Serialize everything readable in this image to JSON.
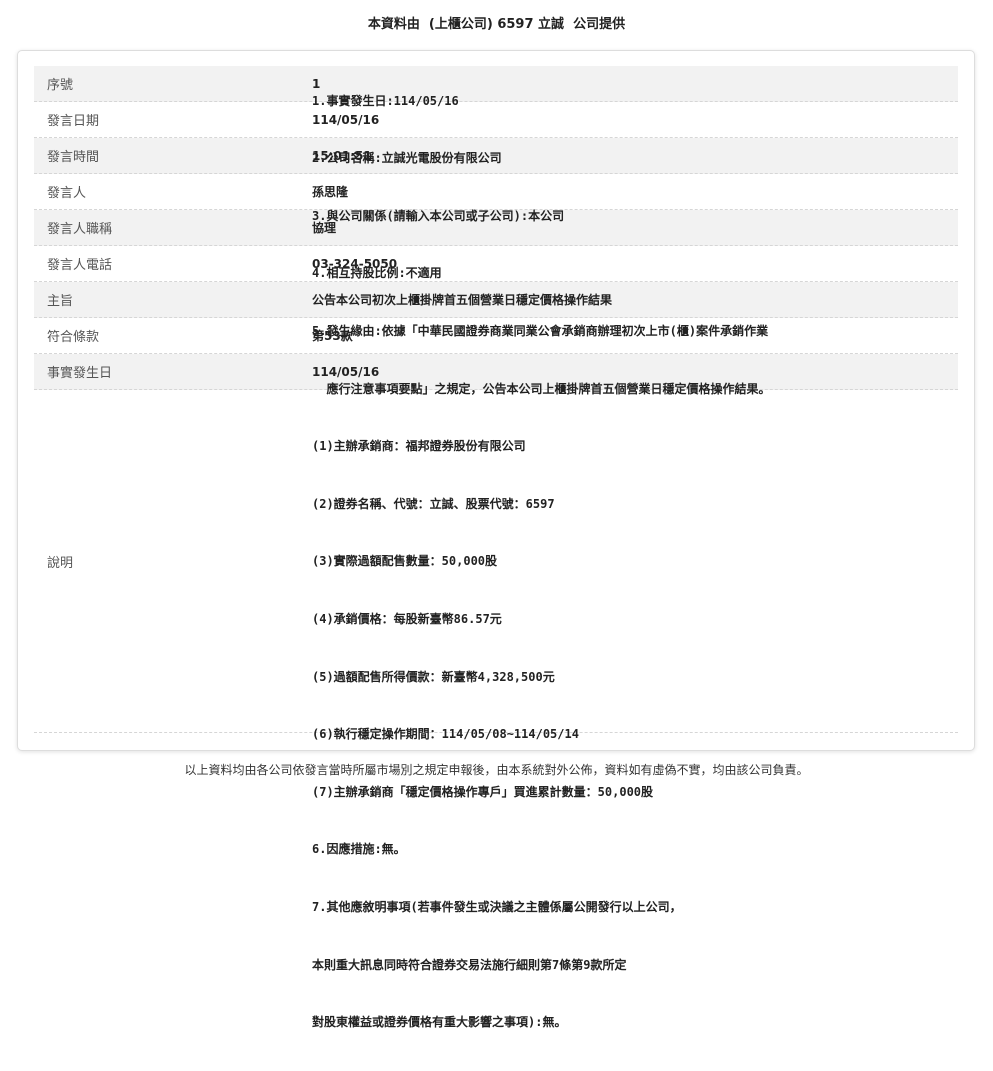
{
  "header": {
    "text": "本資料由  (上櫃公司) 6597 立誠  公司提供"
  },
  "rows": [
    {
      "label": "序號",
      "value": "1"
    },
    {
      "label": "發言日期",
      "value": "114/05/16"
    },
    {
      "label": "發言時間",
      "value": "15:01:51"
    },
    {
      "label": "發言人",
      "value": "孫思隆"
    },
    {
      "label": "發言人職稱",
      "value": "協理"
    },
    {
      "label": "發言人電話",
      "value": "03-324-5050"
    },
    {
      "label": "主旨",
      "value": "公告本公司初次上櫃掛牌首五個營業日穩定價格操作結果"
    },
    {
      "label": "符合條款",
      "value": "第53款"
    },
    {
      "label": "事實發生日",
      "value": "114/05/16"
    }
  ],
  "description": {
    "label": "說明",
    "lines": [
      "1.事實發生日:114/05/16",
      "2.公司名稱:立誠光電股份有限公司",
      "3.與公司關係(請輸入本公司或子公司):本公司",
      "4.相互持股比例:不適用",
      "5.發生緣由:依據「中華民國證券商業同業公會承銷商辦理初次上市(櫃)案件承銷作業",
      "  應行注意事項要點」之規定，公告本公司上櫃掛牌首五個營業日穩定價格操作結果。",
      "(1)主辦承銷商：福邦證券股份有限公司",
      "(2)證券名稱、代號：立誠、股票代號：6597",
      "(3)實際過額配售數量：50,000股",
      "(4)承銷價格：每股新臺幣86.57元",
      "(5)過額配售所得價款：新臺幣4,328,500元",
      "(6)執行穩定操作期間：114/05/08~114/05/14",
      "(7)主辦承銷商「穩定價格操作專戶」買進累計數量：50,000股",
      "6.因應措施:無。",
      "7.其他應敘明事項(若事件發生或決議之主體係屬公開發行以上公司，",
      "本則重大訊息同時符合證券交易法施行細則第7條第9款所定",
      "對股東權益或證券價格有重大影響之事項):無。"
    ]
  },
  "footer": {
    "text": "以上資料均由各公司依發言當時所屬市場別之規定申報後，由本系統對外公佈，資料如有虛偽不實，均由該公司負責。"
  }
}
